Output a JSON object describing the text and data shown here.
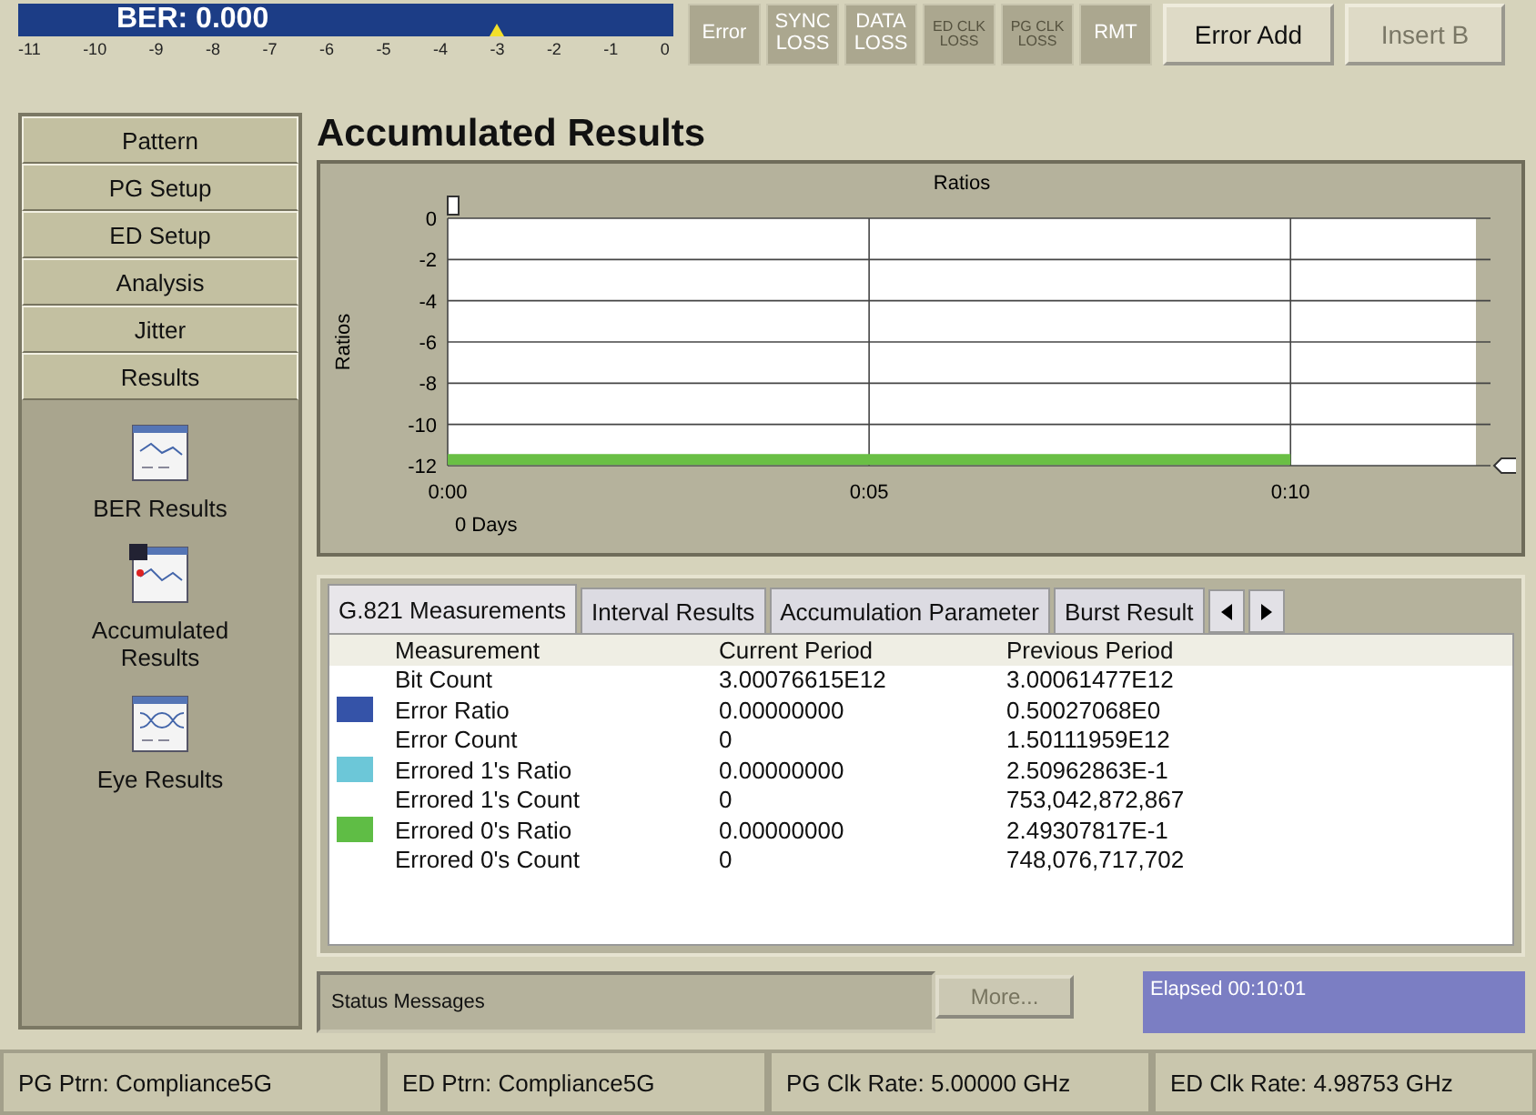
{
  "ber": {
    "label": "BER: 0.000",
    "scale": [
      "-11",
      "-10",
      "-9",
      "-8",
      "-7",
      "-6",
      "-5",
      "-4",
      "-3",
      "-2",
      "-1",
      "0"
    ],
    "level": 0.73
  },
  "indicators": [
    {
      "lines": [
        "Error"
      ],
      "disabled": false
    },
    {
      "lines": [
        "SYNC",
        "LOSS"
      ],
      "disabled": false
    },
    {
      "lines": [
        "DATA",
        "LOSS"
      ],
      "disabled": false
    },
    {
      "lines": [
        "ED CLK",
        "LOSS"
      ],
      "disabled": true
    },
    {
      "lines": [
        "PG CLK",
        "LOSS"
      ],
      "disabled": true
    },
    {
      "lines": [
        "RMT"
      ],
      "disabled": false
    }
  ],
  "buttons": [
    {
      "label": "Error Add",
      "disabled": false
    },
    {
      "label": "Insert B",
      "disabled": true
    }
  ],
  "sidebar": {
    "items": [
      {
        "label": "Pattern"
      },
      {
        "label": "PG Setup"
      },
      {
        "label": "ED Setup"
      },
      {
        "label": "Analysis"
      },
      {
        "label": "Jitter"
      },
      {
        "label": "Results"
      }
    ],
    "tools": [
      {
        "label": "BER Results",
        "kind": "chart"
      },
      {
        "label": "Accumulated Results",
        "kind": "saved"
      },
      {
        "label": "Eye Results",
        "kind": "eye"
      }
    ]
  },
  "title": "Accumulated Results",
  "chart": {
    "chart_data": {
      "type": "line",
      "title": "Ratios",
      "ylabel": "Ratios",
      "xlabel": "0 Days",
      "x": [
        0,
        10
      ],
      "grid": true,
      "series": [
        {
          "color": "#6abf45",
          "values": [
            -11.7,
            -11.7
          ]
        }
      ],
      "xlim": [
        0,
        12.2
      ],
      "ylim": [
        -12,
        0
      ],
      "xticks": [
        {
          "value": 0,
          "label": "0:00"
        },
        {
          "value": 5,
          "label": "0:05"
        },
        {
          "value": 10,
          "label": "0:10"
        }
      ],
      "yticks": [
        0,
        -2,
        -4,
        -6,
        -8,
        -10,
        -12
      ]
    }
  },
  "tabs": [
    {
      "label": "G.821 Measurements",
      "selected": true
    },
    {
      "label": "Interval Results",
      "selected": false
    },
    {
      "label": "Accumulation Parameter",
      "selected": false
    },
    {
      "label": "Burst Result",
      "selected": false
    }
  ],
  "table": {
    "columns": [
      "Measurement",
      "Current Period",
      "Previous Period"
    ],
    "rows": [
      {
        "cells": [
          "Bit Count",
          "3.00076615E12",
          "3.00061477E12"
        ]
      },
      {
        "color": "#3553a8",
        "cells": [
          "Error Ratio",
          "0.00000000",
          "0.50027068E0"
        ]
      },
      {
        "cells": [
          "Error Count",
          "0",
          "1.50111959E12"
        ]
      },
      {
        "color": "#6cc7d8",
        "cells": [
          "Errored 1's Ratio",
          "0.00000000",
          "2.50962863E-1"
        ]
      },
      {
        "cells": [
          "Errored 1's Count",
          "0",
          "753,042,872,867"
        ]
      },
      {
        "color": "#5fbd45",
        "cells": [
          "Errored 0's Ratio",
          "0.00000000",
          "2.49307817E-1"
        ]
      },
      {
        "cells": [
          "Errored 0's Count",
          "0",
          "748,076,717,702"
        ]
      }
    ]
  },
  "status": {
    "messages": "Status Messages",
    "more": {
      "label": "More...",
      "disabled": true
    },
    "elapsed": "Elapsed 00:10:01"
  },
  "status_bar": [
    "PG Ptrn: Compliance5G",
    "ED Ptrn: Compliance5G",
    "PG Clk Rate: 5.00000 GHz",
    "ED Clk Rate: 4.98753 GHz"
  ]
}
